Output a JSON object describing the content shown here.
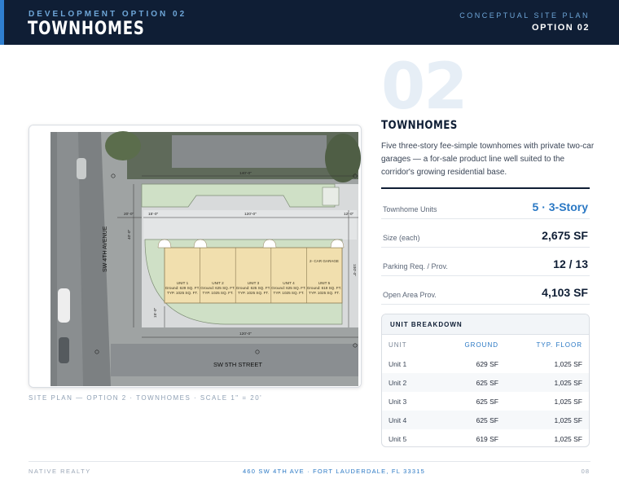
{
  "header": {
    "eyebrow": "DEVELOPMENT OPTION 02",
    "title": "TOWNHOMES",
    "right_label": "CONCEPTUAL SITE PLAN",
    "right_value": "OPTION 02"
  },
  "plan": {
    "street_west": "SW 4TH AVENUE",
    "street_south": "SW 5TH STREET",
    "garage_label": "2- CAR GARAGE",
    "units": [
      {
        "name": "UNIT 1",
        "ground": "Ground: 629 SQ. FT.",
        "typ": "TYP. 1025 SQ. FT."
      },
      {
        "name": "UNIT 2",
        "ground": "Ground: 625 SQ. FT.",
        "typ": "TYP. 1025 SQ. FT."
      },
      {
        "name": "UNIT 3",
        "ground": "Ground: 625 SQ. FT.",
        "typ": "TYP. 1025 SQ. FT."
      },
      {
        "name": "UNIT 4",
        "ground": "Ground: 625 SQ. FT.",
        "typ": "TYP. 1025 SQ. FT."
      },
      {
        "name": "UNIT 5",
        "ground": "Ground: 619 SQ. FT.",
        "typ": "TYP. 1025 SQ. FT."
      }
    ],
    "dims": {
      "top": "140'-0\"",
      "left_setback": "20'-0\"",
      "left_inner": "15'-0\"",
      "center": "120'-0\"",
      "right_setback": "12'-0\"",
      "bottom_setback": "15'-0\"",
      "bottom_center": "120'-0\"",
      "left_depth": "40'-0\"",
      "right_depth": "100'-0\""
    },
    "caption": "SITE PLAN — OPTION 2 · TOWNHOMES · SCALE 1\" = 20'"
  },
  "summary": {
    "number": "02",
    "title": "TOWNHOMES",
    "description": "Five three-story fee-simple townhomes with private two-car garages — a for-sale product line well suited to the corridor's growing residential base.",
    "rows": [
      {
        "label": "Townhome Units",
        "value": "5 · 3-Story"
      },
      {
        "label": "Size (each)",
        "value": "2,675 SF"
      },
      {
        "label": "Parking Req. / Prov.",
        "value": "12 / 13"
      },
      {
        "label": "Open Area Prov.",
        "value": "4,103 SF"
      }
    ]
  },
  "breakdown": {
    "title": "UNIT BREAKDOWN",
    "columns": [
      "UNIT",
      "GROUND",
      "TYP. FLOOR"
    ],
    "rows": [
      {
        "unit": "Unit 1",
        "ground": "629 SF",
        "typ": "1,025 SF"
      },
      {
        "unit": "Unit 2",
        "ground": "625 SF",
        "typ": "1,025 SF"
      },
      {
        "unit": "Unit 3",
        "ground": "625 SF",
        "typ": "1,025 SF"
      },
      {
        "unit": "Unit 4",
        "ground": "625 SF",
        "typ": "1,025 SF"
      },
      {
        "unit": "Unit 5",
        "ground": "619 SF",
        "typ": "1,025 SF"
      }
    ]
  },
  "footer": {
    "left": "NATIVE REALTY",
    "center": "460 SW 4TH AVE · FORT LAUDERDALE, FL 33315",
    "page": "08"
  },
  "colors": {
    "navy": "#0f1e35",
    "accent_blue": "#2a78c4",
    "landscape_green": "#cfe0c6",
    "unit_fill": "#f1dfae"
  }
}
